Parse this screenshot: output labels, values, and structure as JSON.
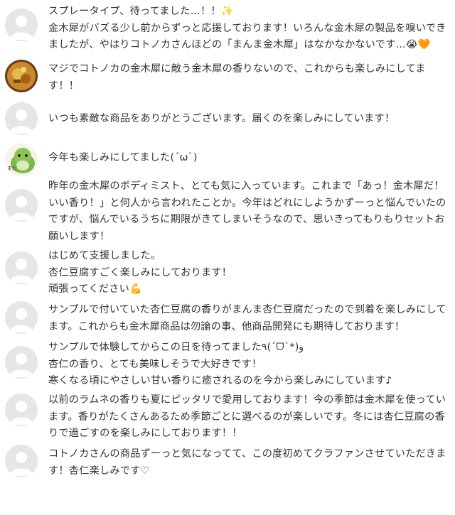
{
  "comments": [
    {
      "avatar": "default-avatar-icon",
      "text": "スプレータイプ、待ってました…！！✨\n金木犀がバズる少し前からずっと応援しております！いろんな金木犀の製品を嗅いできましたが、やはりコトノカさんほどの「まんま金木犀」はなかなかないです…😭🧡"
    },
    {
      "avatar": "food-photo-avatar",
      "text": "マジでコトノカの金木犀に敵う金木犀の香りないので、これからも楽しみにしてます！！"
    },
    {
      "avatar": "default-avatar-icon",
      "text": "いつも素敵な商品をありがとうございます。届くのを楽しみにしています！"
    },
    {
      "avatar": "green-character-avatar",
      "text": "今年も楽しみにしてました(´ω`)"
    },
    {
      "avatar": "default-avatar-icon",
      "text": "昨年の金木犀のボディミスト、とても気に入っています。これまで「あっ！金木犀だ！いい香り！」と何人から言われたことか。今年はどれにしようかずーっと悩んでいたのですが、悩んでいるうちに期限がきてしまいそうなので、思いきってもりもりセットお願いします！"
    },
    {
      "avatar": "default-avatar-icon",
      "text": "はじめて支援しました。\n杏仁豆腐すごく楽しみにしております！\n頑張ってください💪"
    },
    {
      "avatar": "default-avatar-icon",
      "text": "サンプルで付いていた杏仁豆腐の香りがまんま杏仁豆腐だったので到着を楽しみにしてます。これからも金木犀商品は勿論の事、他商品開発にも期待しております！"
    },
    {
      "avatar": "default-avatar-icon",
      "text": "サンプルで体験してからこの日を待ってました٩(ˊᗜˋ*)و\n杏仁の香り、とても美味しそうで大好きです！\n寒くなる頃にやさしい甘い香りに癒されるのを今から楽しみにしています♪"
    },
    {
      "avatar": "default-avatar-icon",
      "text": "以前のラムネの香りも夏にピッタリで愛用しております！今の季節は金木犀を使っています。香りがたくさんあるため季節ごとに選べるのが楽しいです。冬には杏仁豆腐の香りで過ごすのを楽しみにしております！！"
    },
    {
      "avatar": "default-avatar-icon",
      "text": "コトノカさんの商品ずーっと気になってて、この度初めてクラファンさせていただきます！杏仁楽しみです♡"
    }
  ]
}
